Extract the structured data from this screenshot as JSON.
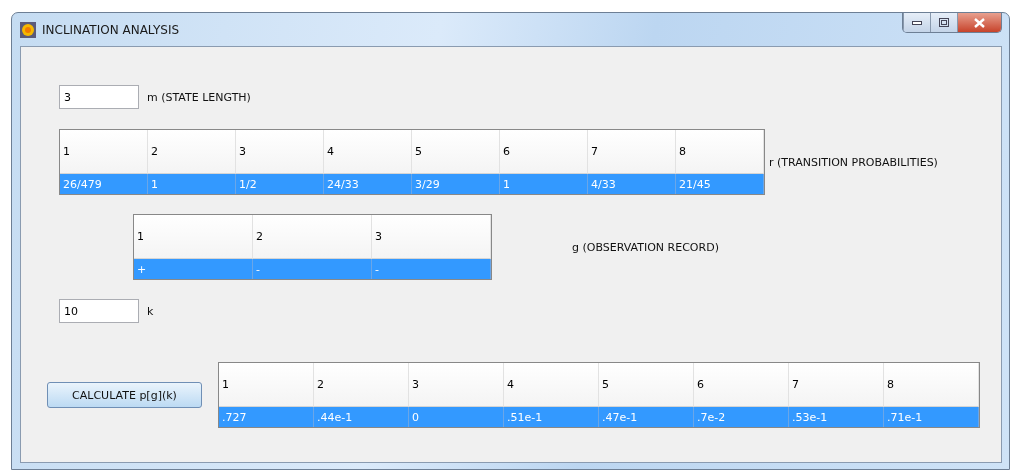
{
  "window": {
    "title": "INCLINATION ANALYSIS"
  },
  "m_field": {
    "value": "3",
    "label": "m (STATE LENGTH)"
  },
  "r_table": {
    "label": "r (TRANSITION PROBABILITIES)",
    "columns": [
      "1",
      "2",
      "3",
      "4",
      "5",
      "6",
      "7",
      "8"
    ],
    "rows": [
      {
        "cells": [
          "26/479",
          "1",
          "1/2",
          "24/33",
          "3/29",
          "1",
          "4/33",
          "21/45"
        ],
        "selected": true
      }
    ]
  },
  "g_table": {
    "label": "g (OBSERVATION RECORD)",
    "columns": [
      "1",
      "2",
      "3"
    ],
    "rows": [
      {
        "cells": [
          "+",
          "-",
          "-"
        ],
        "selected": true
      }
    ]
  },
  "k_field": {
    "value": "10",
    "label": "k"
  },
  "calculate_button": {
    "label": "CALCULATE p[g](k)"
  },
  "p_table": {
    "columns": [
      "1",
      "2",
      "3",
      "4",
      "5",
      "6",
      "7",
      "8"
    ],
    "rows": [
      {
        "cells": [
          ".727",
          ".44e-1",
          "0",
          ".51e-1",
          ".47e-1",
          ".7e-2",
          ".53e-1",
          ".71e-1"
        ],
        "selected": true
      }
    ]
  }
}
